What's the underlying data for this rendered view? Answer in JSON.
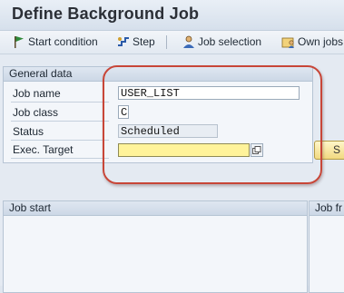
{
  "window": {
    "title": "Define Background Job"
  },
  "toolbar": {
    "start_condition": "Start condition",
    "step": "Step",
    "job_selection": "Job selection",
    "own_jobs": "Own jobs"
  },
  "general": {
    "header": "General data",
    "job_name_label": "Job name",
    "job_name_value": "USER_LIST",
    "job_class_label": "Job class",
    "job_class_value": "C",
    "status_label": "Status",
    "status_value": "Scheduled",
    "exec_target_label": "Exec. Target",
    "exec_target_value": "",
    "side_button_label": "S"
  },
  "job_start": {
    "header": "Job start"
  },
  "job_frequency": {
    "header": "Job fr"
  },
  "colors": {
    "highlight": "#c84638",
    "required_field": "#fff39a"
  }
}
